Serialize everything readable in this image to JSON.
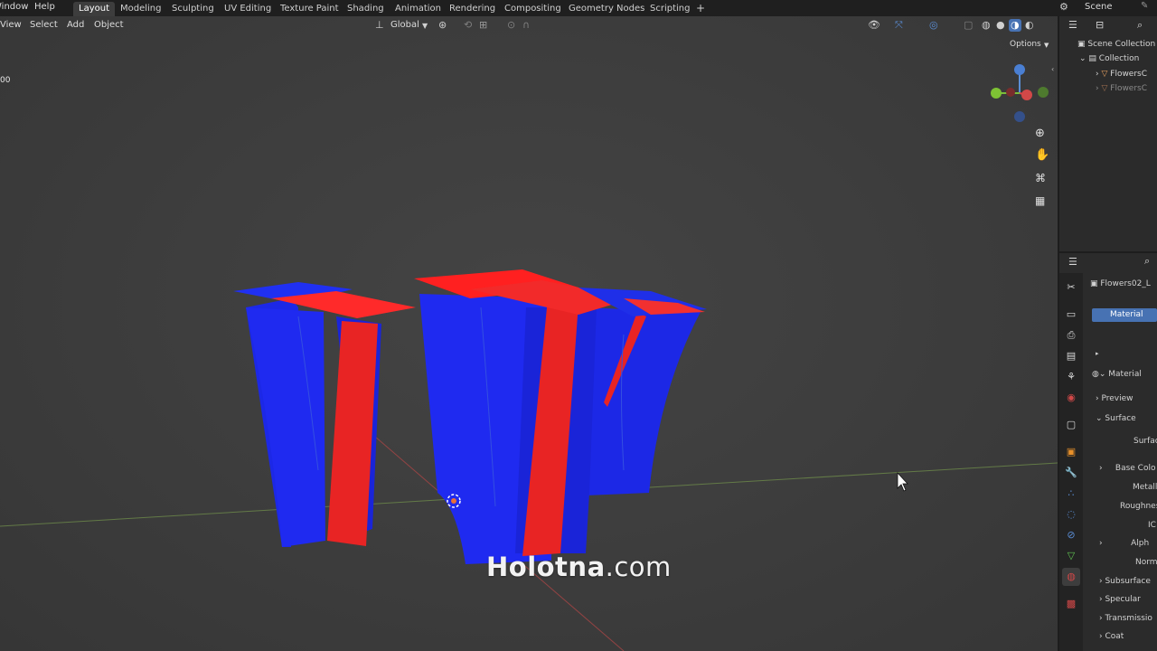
{
  "topbar": {
    "menus": [
      "Window",
      "Help"
    ],
    "workspaces": [
      "Layout",
      "Modeling",
      "Sculpting",
      "UV Editing",
      "Texture Paint",
      "Shading",
      "Animation",
      "Rendering",
      "Compositing",
      "Geometry Nodes",
      "Scripting"
    ],
    "active_workspace": "Layout",
    "add_label": "+",
    "scene_label": "Scene"
  },
  "viewport_header": {
    "menus": [
      "View",
      "Select",
      "Add",
      "Object"
    ],
    "transform_orientation": "Global",
    "options_label": "Options",
    "corner_text": "00"
  },
  "outliner": {
    "scene_collection": "Scene Collection",
    "collection": "Collection",
    "items": [
      "FlowersC",
      "FlowersC"
    ]
  },
  "properties": {
    "object_name": "Flowers02_L",
    "material_slot": "Material",
    "material_name": "Material",
    "rows": [
      "Preview",
      "Surface",
      "Surfac",
      "Base Colo",
      "Metall",
      "Roughnes",
      "IC",
      "Alph",
      "Norm",
      "Subsurface",
      "Specular",
      "Transmissio",
      "Coat"
    ]
  },
  "watermark": {
    "bold": "Holotna",
    "light": ".com"
  },
  "colors": {
    "accent": "#4772b3",
    "active_tab": "#3d3d3d",
    "viewport_bg": "#3e3e3e",
    "mesh_blue": "#1c28e6",
    "mesh_red": "#e82424"
  },
  "icons": [
    "blender-icon",
    "cursor-icon",
    "zoom-icon",
    "hand-icon",
    "camera-icon",
    "grid-icon",
    "gizmo-icon",
    "origin-icon",
    "material-icon",
    "wrench-icon",
    "object-icon"
  ]
}
